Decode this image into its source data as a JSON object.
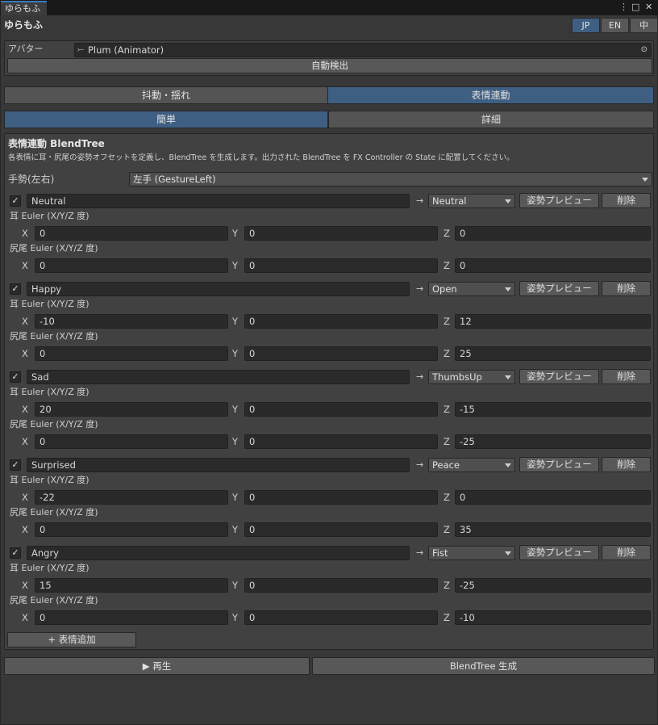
{
  "tab": {
    "title": "ゆらもふ"
  },
  "window_controls": {
    "menu": "⋮",
    "maximize": "□",
    "close": "✕"
  },
  "app_title": "ゆらもふ",
  "languages": [
    {
      "label": "JP",
      "active": true
    },
    {
      "label": "EN",
      "active": false
    },
    {
      "label": "中",
      "active": false
    }
  ],
  "avatar": {
    "label": "アバター",
    "value": "Plum (Animator)",
    "auto_detect": "自動検出"
  },
  "main_tabs": [
    {
      "label": "抖動・揺れ",
      "active": false
    },
    {
      "label": "表情連動",
      "active": true
    }
  ],
  "mode_tabs": [
    {
      "label": "簡単",
      "active": true
    },
    {
      "label": "詳細",
      "active": false
    }
  ],
  "section": {
    "title": "表情連動 BlendTree",
    "description": "各表情に耳・尻尾の姿勢オフセットを定義し、BlendTree を生成します。出力された BlendTree を FX Controller の State に配置してください。"
  },
  "gesture": {
    "label": "手勢(左右)",
    "value": "左手 (GestureLeft)"
  },
  "labels": {
    "ear_euler": "耳 Euler (X/Y/Z 度)",
    "tail_euler": "尻尾 Euler (X/Y/Z 度)",
    "x": "X",
    "y": "Y",
    "z": "Z",
    "arrow": "→",
    "preview": "姿勢プレビュー",
    "delete": "削除",
    "check": "✓"
  },
  "expressions": [
    {
      "name": "Neutral",
      "gesture": "Neutral",
      "ear": [
        "0",
        "0",
        "0"
      ],
      "tail": [
        "0",
        "0",
        "0"
      ]
    },
    {
      "name": "Happy",
      "gesture": "Open",
      "ear": [
        "-10",
        "0",
        "12"
      ],
      "tail": [
        "0",
        "0",
        "25"
      ]
    },
    {
      "name": "Sad",
      "gesture": "ThumbsUp",
      "ear": [
        "20",
        "0",
        "-15"
      ],
      "tail": [
        "0",
        "0",
        "-25"
      ]
    },
    {
      "name": "Surprised",
      "gesture": "Peace",
      "ear": [
        "-22",
        "0",
        "0"
      ],
      "tail": [
        "0",
        "0",
        "35"
      ]
    },
    {
      "name": "Angry",
      "gesture": "Fist",
      "ear": [
        "15",
        "0",
        "-25"
      ],
      "tail": [
        "0",
        "0",
        "-10"
      ]
    }
  ],
  "add_expression": "+ 表情追加",
  "footer": {
    "play": "▶ 再生",
    "generate": "BlendTree 生成"
  }
}
